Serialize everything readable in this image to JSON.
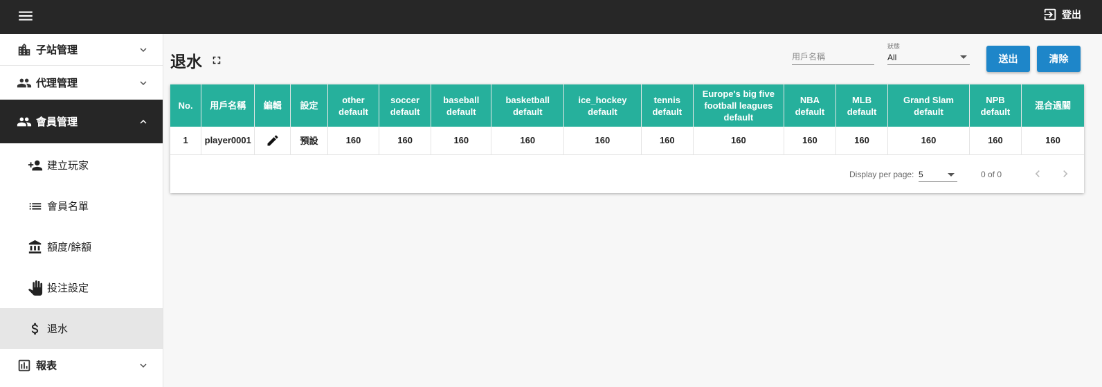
{
  "header": {
    "menu_icon": "hamburger-menu-icon",
    "logout_label": "登出",
    "logout_icon": "logout-icon"
  },
  "sidebar": {
    "groups": [
      {
        "label": "子站管理",
        "icon": "building-icon",
        "expanded": false
      },
      {
        "label": "代理管理",
        "icon": "people-icon",
        "expanded": false
      },
      {
        "label": "會員管理",
        "icon": "people-icon",
        "expanded": true
      },
      {
        "label": "報表",
        "icon": "bar-chart-icon",
        "expanded": false
      }
    ],
    "member_items": [
      {
        "label": "建立玩家",
        "icon": "person-add-icon"
      },
      {
        "label": "會員名單",
        "icon": "list-icon"
      },
      {
        "label": "額度/餘額",
        "icon": "bank-icon"
      },
      {
        "label": "投注設定",
        "icon": "hand-icon"
      },
      {
        "label": "退水",
        "icon": "dollar-icon",
        "active": true
      }
    ]
  },
  "main": {
    "title": "退水",
    "search": {
      "placeholder": "用戶名稱",
      "value": ""
    },
    "status": {
      "label": "狀態",
      "value": "All"
    },
    "submit_label": "送出",
    "clear_label": "清除"
  },
  "table": {
    "headers": [
      "No.",
      "用戶名稱",
      "編輯",
      "設定",
      "other default",
      "soccer default",
      "baseball default",
      "basketball default",
      "ice_hockey default",
      "tennis default",
      "Europe's big five football leagues default",
      "NBA default",
      "MLB default",
      "Grand Slam default",
      "NPB default",
      "混合過關"
    ],
    "rows": [
      {
        "no": "1",
        "username": "player0001",
        "setting": "預設",
        "values": [
          "160",
          "160",
          "160",
          "160",
          "160",
          "160",
          "160",
          "160",
          "160",
          "160",
          "160",
          "160"
        ]
      }
    ]
  },
  "pagination": {
    "per_page_label": "Display per page:",
    "per_page_value": "5",
    "count": "0 of 0"
  },
  "colors": {
    "topbar": "#272727",
    "header_teal": "#26b09c",
    "button_blue": "#1e86c9",
    "active_group": "#262626"
  }
}
